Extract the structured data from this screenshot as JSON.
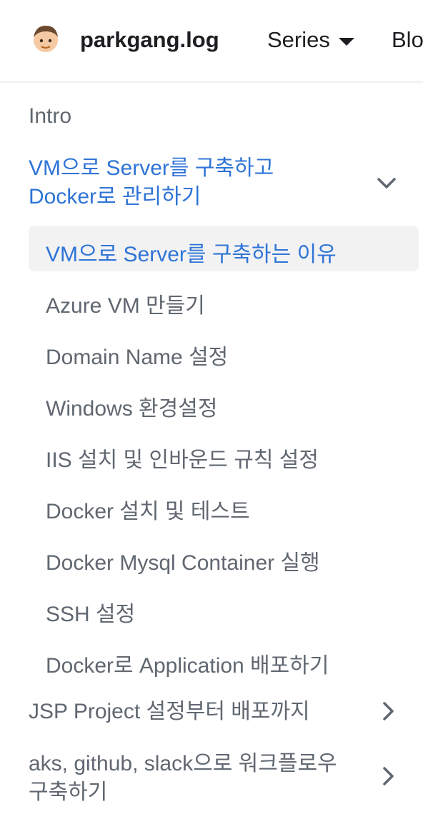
{
  "header": {
    "brand": "parkgang.log",
    "nav_series": "Series",
    "nav_blog": "Blo"
  },
  "sidebar": {
    "intro": "Intro",
    "categories": [
      {
        "label": "VM으로 Server를 구축하고 Docker로 관리하기",
        "expanded": true,
        "items": [
          {
            "label": "VM으로 Server를 구축하는 이유",
            "active": true
          },
          {
            "label": "Azure VM 만들기"
          },
          {
            "label": "Domain Name 설정"
          },
          {
            "label": "Windows 환경설정"
          },
          {
            "label": "IIS 설치 및 인바운드 규칙 설정"
          },
          {
            "label": "Docker 설치 및 테스트"
          },
          {
            "label": "Docker Mysql Container 실행"
          },
          {
            "label": "SSH 설정"
          },
          {
            "label": "Docker로 Application 배포하기"
          }
        ]
      },
      {
        "label": "JSP Project 설정부터 배포까지",
        "expanded": false
      },
      {
        "label": "aks, github, slack으로 워크플로우 구축하기",
        "expanded": false
      }
    ]
  },
  "colors": {
    "accent": "#2e74d6",
    "text": "#606770",
    "active_bg": "#f2f2f3"
  },
  "icons": {
    "expand": "chevron-down-icon",
    "collapsed": "chevron-right-icon",
    "dropdown": "caret-down-icon"
  }
}
